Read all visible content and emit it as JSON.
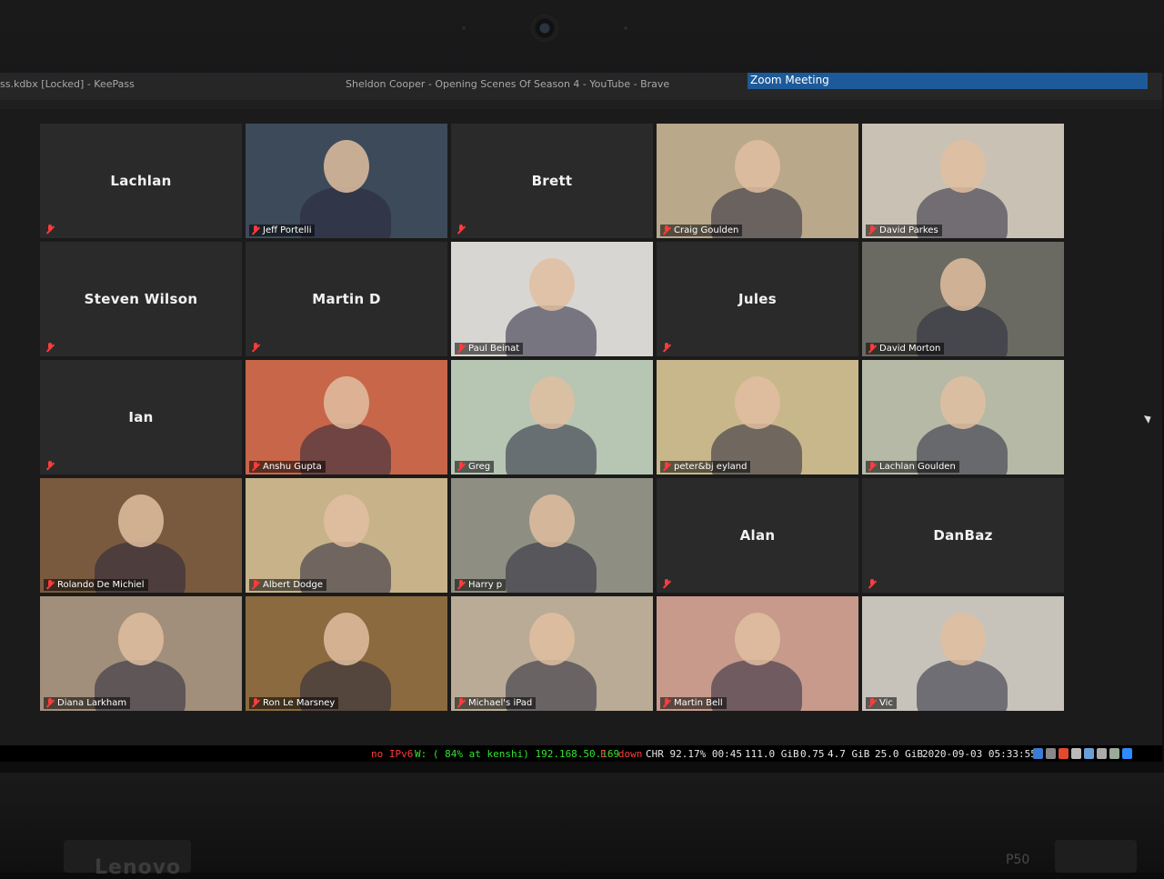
{
  "laptop": {
    "brand": "Lenovo",
    "model": "P50"
  },
  "window_titles": {
    "left": "ss.kdbx [Locked] - KeePass",
    "center": "Sheldon Cooper - Opening Scenes Of Season 4 - YouTube - Brave",
    "active": "Zoom Meeting"
  },
  "participants": [
    {
      "name": "Lachlan",
      "video": false
    },
    {
      "name": "Jeff Portelli",
      "video": true,
      "bg": "#3d4a5a"
    },
    {
      "name": "Brett",
      "video": false
    },
    {
      "name": "Craig Goulden",
      "video": true,
      "bg": "#b9a88a"
    },
    {
      "name": "David Parkes",
      "video": true,
      "bg": "#c9c2b4"
    },
    {
      "name": "Steven Wilson",
      "video": false
    },
    {
      "name": "Martin D",
      "video": false
    },
    {
      "name": "Paul Beinat",
      "video": true,
      "bg": "#d8d6d2"
    },
    {
      "name": "Jules",
      "video": false
    },
    {
      "name": "David Morton",
      "video": true,
      "bg": "#6b6a62"
    },
    {
      "name": "Ian",
      "video": false
    },
    {
      "name": "Anshu Gupta",
      "video": true,
      "bg": "#c8664a"
    },
    {
      "name": "Greg",
      "video": true,
      "bg": "#b7c5b3"
    },
    {
      "name": "peter&bj eyland",
      "video": true,
      "bg": "#c8b78a"
    },
    {
      "name": "Lachlan Goulden",
      "video": true,
      "bg": "#b5b9a6"
    },
    {
      "name": "Rolando De Michiel",
      "video": true,
      "bg": "#7a5a3e"
    },
    {
      "name": "Albert Dodge",
      "video": true,
      "bg": "#c7b28a"
    },
    {
      "name": "Harry p",
      "video": true,
      "bg": "#8e8e82"
    },
    {
      "name": "Alan",
      "video": false
    },
    {
      "name": "DanBaz",
      "video": false
    },
    {
      "name": "Diana Larkham",
      "video": true,
      "bg": "#a28f7b"
    },
    {
      "name": "Ron Le Marsney",
      "video": true,
      "bg": "#8a6a3e"
    },
    {
      "name": "Michael's iPad",
      "video": true,
      "bg": "#b9ab96"
    },
    {
      "name": "Martin Bell",
      "video": true,
      "bg": "#c79a8c"
    },
    {
      "name": "Vic",
      "video": true,
      "bg": "#c7c3ba"
    }
  ],
  "statusbar": {
    "ipv6": "no IPv6",
    "wifi": "W: ( 84% at kenshi) 192.168.50.169",
    "eth": "E: down",
    "battery": "CHR 92.17% 00:45",
    "disk1": "111.0 GiB",
    "load": "0.75",
    "mem": "4.7 GiB",
    "disk2": "25.0 GiB",
    "datetime": "2020-09-03 05:33:55",
    "colors": {
      "ipv6": "#ff3b3b",
      "wifi": "#32e532",
      "eth": "#ff3b3b",
      "default": "#e8e8e8"
    }
  }
}
